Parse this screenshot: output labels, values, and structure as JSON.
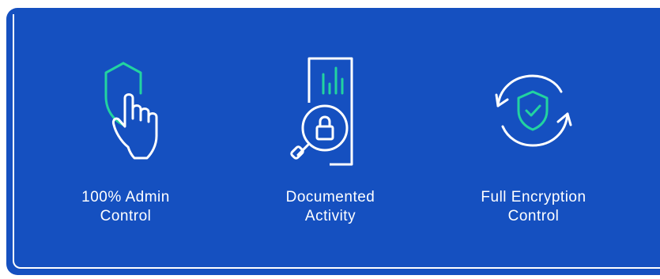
{
  "colors": {
    "panel_bg": "#1550c0",
    "icon_white": "#ffffff",
    "icon_accent": "#22d3a0"
  },
  "features": [
    {
      "icon": "shield-hand-icon",
      "label_line1": "100% Admin",
      "label_line2": "Control"
    },
    {
      "icon": "document-lock-magnifier-icon",
      "label_line1": "Documented",
      "label_line2": "Activity"
    },
    {
      "icon": "shield-check-sync-icon",
      "label_line1": "Full Encryption",
      "label_line2": "Control"
    }
  ]
}
